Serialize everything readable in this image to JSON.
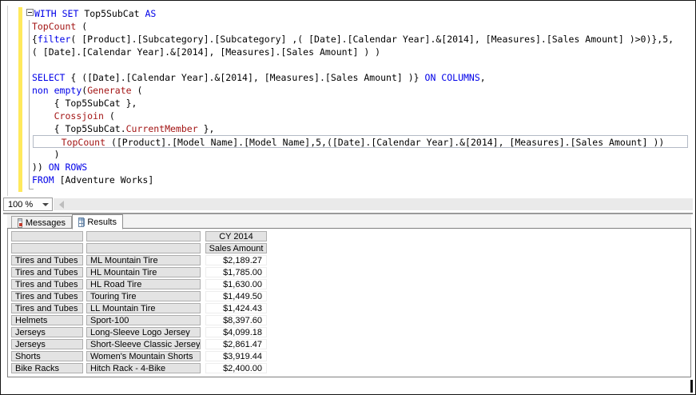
{
  "colors": {
    "keyword": "#0000E8",
    "function": "#A31515",
    "change_bar": "#FFE95C",
    "grid_header_bg": "#E3E3E3",
    "tab_active_bg": "#FFFFFF"
  },
  "editor": {
    "lines": [
      {
        "fold": true,
        "boxed": false,
        "segments": [
          [
            "k",
            "WITH SET"
          ],
          [
            "p",
            " Top5SubCat "
          ],
          [
            "k",
            "AS"
          ]
        ]
      },
      {
        "fold": false,
        "boxed": false,
        "segments": [
          [
            "p",
            " "
          ],
          [
            "f",
            "TopCount"
          ],
          [
            "p",
            " ("
          ]
        ]
      },
      {
        "fold": false,
        "boxed": false,
        "segments": [
          [
            "p",
            " {"
          ],
          [
            "k",
            "filter"
          ],
          [
            "p",
            "( [Product].[Subcategory].[Subcategory] ,( [Date].[Calendar Year].&[2014], [Measures].[Sales Amount] )>0)},5,"
          ]
        ]
      },
      {
        "fold": false,
        "boxed": false,
        "segments": [
          [
            "p",
            " ( [Date].[Calendar Year].&[2014], [Measures].[Sales Amount] ) )"
          ]
        ]
      },
      {
        "fold": false,
        "boxed": false,
        "segments": []
      },
      {
        "fold": false,
        "boxed": false,
        "segments": [
          [
            "p",
            " "
          ],
          [
            "k",
            "SELECT"
          ],
          [
            "p",
            " { ([Date].[Calendar Year].&[2014], [Measures].[Sales Amount] )} "
          ],
          [
            "k",
            "ON COLUMNS"
          ],
          [
            "p",
            ","
          ]
        ]
      },
      {
        "fold": false,
        "boxed": false,
        "segments": [
          [
            "p",
            " "
          ],
          [
            "k",
            "non empty"
          ],
          [
            "p",
            "("
          ],
          [
            "f",
            "Generate"
          ],
          [
            "p",
            " ("
          ]
        ]
      },
      {
        "fold": false,
        "boxed": false,
        "segments": [
          [
            "p",
            "     { Top5SubCat },"
          ]
        ]
      },
      {
        "fold": false,
        "boxed": false,
        "segments": [
          [
            "p",
            "     "
          ],
          [
            "f",
            "Crossjoin"
          ],
          [
            "p",
            " ("
          ]
        ]
      },
      {
        "fold": false,
        "boxed": false,
        "segments": [
          [
            "p",
            "     { Top5SubCat."
          ],
          [
            "f",
            "CurrentMember"
          ],
          [
            "p",
            " },"
          ]
        ]
      },
      {
        "fold": false,
        "boxed": true,
        "segments": [
          [
            "p",
            "     "
          ],
          [
            "f",
            "TopCount"
          ],
          [
            "p",
            " ([Product].[Model Name].[Model Name],5,([Date].[Calendar Year].&[2014], [Measures].[Sales Amount] ))"
          ]
        ]
      },
      {
        "fold": false,
        "boxed": false,
        "segments": [
          [
            "p",
            "     )"
          ]
        ]
      },
      {
        "fold": false,
        "boxed": false,
        "segments": [
          [
            "p",
            " )) "
          ],
          [
            "k",
            "ON ROWS"
          ]
        ]
      },
      {
        "fold": false,
        "boxed": false,
        "segments": [
          [
            "p",
            " "
          ],
          [
            "k",
            "FROM"
          ],
          [
            "p",
            " [Adventure Works]"
          ]
        ]
      }
    ]
  },
  "zoom_control": {
    "value": "100 %"
  },
  "result_tabs": {
    "messages": "Messages",
    "results": "Results"
  },
  "grid": {
    "header_row_1": [
      "",
      "",
      "CY 2014"
    ],
    "header_row_2": [
      "",
      "",
      "Sales Amount"
    ],
    "rows": [
      [
        "Tires and Tubes",
        "ML Mountain Tire",
        "$2,189.27"
      ],
      [
        "Tires and Tubes",
        "HL Mountain Tire",
        "$1,785.00"
      ],
      [
        "Tires and Tubes",
        "HL Road Tire",
        "$1,630.00"
      ],
      [
        "Tires and Tubes",
        "Touring Tire",
        "$1,449.50"
      ],
      [
        "Tires and Tubes",
        "LL Mountain Tire",
        "$1,424.43"
      ],
      [
        "Helmets",
        "Sport-100",
        "$8,397.60"
      ],
      [
        "Jerseys",
        "Long-Sleeve Logo Jersey",
        "$4,099.18"
      ],
      [
        "Jerseys",
        "Short-Sleeve Classic Jersey",
        "$2,861.47"
      ],
      [
        "Shorts",
        "Women's Mountain Shorts",
        "$3,919.44"
      ],
      [
        "Bike Racks",
        "Hitch Rack - 4-Bike",
        "$2,400.00"
      ]
    ]
  }
}
